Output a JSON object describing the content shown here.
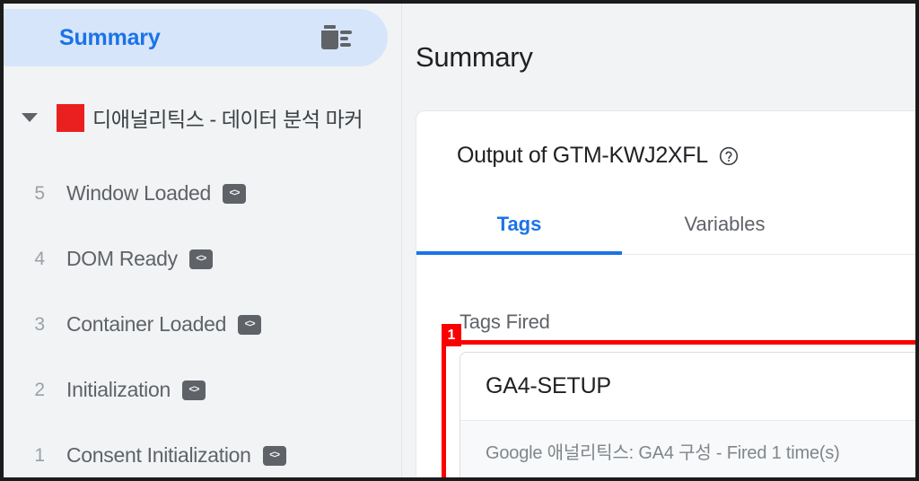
{
  "sidebar": {
    "summary_pill": {
      "label": "Summary",
      "delete_icon": "trash-icon"
    },
    "container": {
      "caret_icon": "chevron-down-icon",
      "swatch_color": "#ea2020",
      "name": "디애널리틱스 - 데이터 분석 마커"
    },
    "events": [
      {
        "num": "5",
        "label": "Window Loaded",
        "badge": "<>"
      },
      {
        "num": "4",
        "label": "DOM Ready",
        "badge": "<>"
      },
      {
        "num": "3",
        "label": "Container Loaded",
        "badge": "<>"
      },
      {
        "num": "2",
        "label": "Initialization",
        "badge": "<>"
      },
      {
        "num": "1",
        "label": "Consent Initialization",
        "badge": "<>"
      }
    ]
  },
  "main": {
    "title": "Summary",
    "output_card": {
      "heading": "Output of GTM-KWJ2XFL",
      "help_icon": "help-circle-icon",
      "tabs": [
        {
          "label": "Tags",
          "active": true
        },
        {
          "label": "Variables",
          "active": false
        }
      ],
      "tags_fired_label": "Tags Fired",
      "tags": [
        {
          "name": "GA4-SETUP",
          "detail": "Google 애널리틱스: GA4 구성 - Fired 1 time(s)"
        }
      ]
    }
  },
  "annotation": {
    "badge": "1",
    "color": "#fa0000"
  },
  "colors": {
    "accent_blue": "#1a73e8",
    "pill_blue": "#d7e5fb",
    "sidebar_bg": "#f1f3f4",
    "annotation_red": "#fa0000",
    "container_red": "#ea2020"
  }
}
